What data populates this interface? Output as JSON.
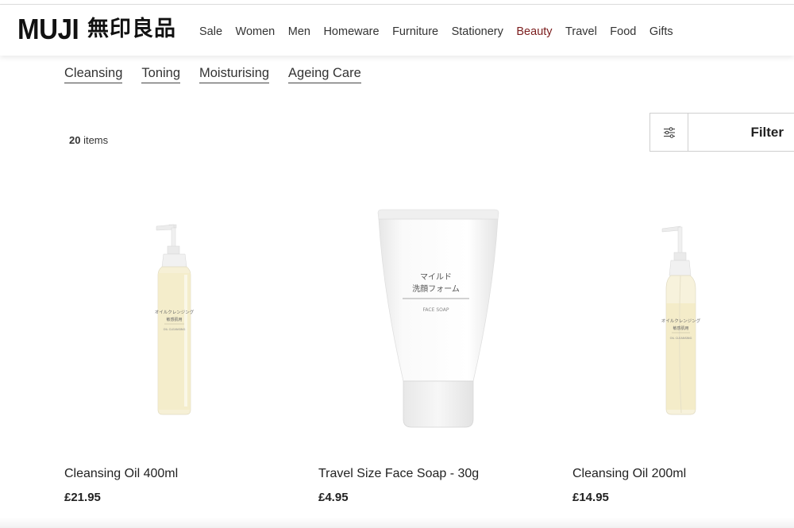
{
  "brand": {
    "name": "MUJI",
    "name_jp": "無印良品"
  },
  "nav": [
    {
      "label": "Sale"
    },
    {
      "label": "Women"
    },
    {
      "label": "Men"
    },
    {
      "label": "Homeware"
    },
    {
      "label": "Furniture"
    },
    {
      "label": "Stationery"
    },
    {
      "label": "Beauty",
      "active": true
    },
    {
      "label": "Travel"
    },
    {
      "label": "Food"
    },
    {
      "label": "Gifts"
    }
  ],
  "accent_color": "#7b1d1d",
  "subnav": [
    {
      "label": "Cleansing"
    },
    {
      "label": "Toning"
    },
    {
      "label": "Moisturising"
    },
    {
      "label": "Ageing Care"
    }
  ],
  "results": {
    "count": "20",
    "suffix": " items"
  },
  "filter": {
    "label": "Filter",
    "icon": "sliders-icon"
  },
  "products": [
    {
      "name": "Cleansing Oil 400ml",
      "price": "£21.95",
      "label_jp": "オイルクレンジング",
      "label_sub": "敏感肌用",
      "label_en": "OIL CLEANSING"
    },
    {
      "name": "Travel Size Face Soap - 30g",
      "price": "£4.95",
      "label_jp": "マイルド",
      "label_jp2": "洗顔フォーム",
      "label_en": "FACE SOAP"
    },
    {
      "name": "Cleansing Oil 200ml",
      "price": "£14.95",
      "label_jp": "オイルクレンジング",
      "label_sub": "敏感肌用",
      "label_en": "OIL CLEANSING"
    }
  ]
}
